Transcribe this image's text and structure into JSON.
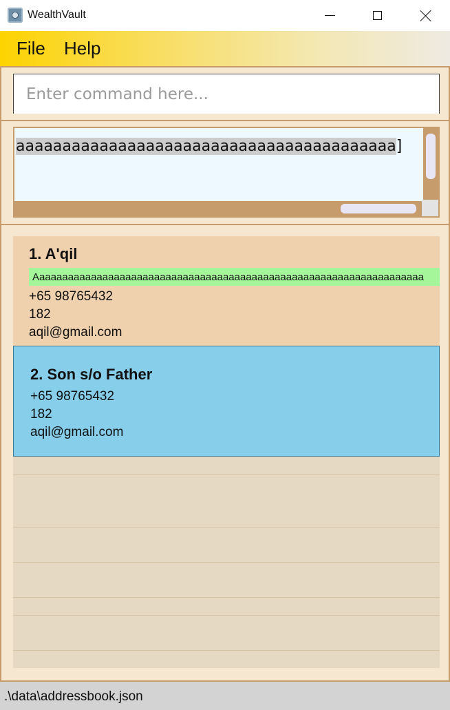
{
  "window": {
    "title": "WealthVault"
  },
  "menu": {
    "items": [
      "File",
      "Help"
    ]
  },
  "command": {
    "placeholder": "Enter command here...",
    "value": ""
  },
  "result": {
    "selected_text": "aaaaaaaaaaaaaaaaaaaaaaaaaaaaaaaaaaaaaaaaa",
    "trailing_text": "]"
  },
  "persons": [
    {
      "index_name": "1. A'qil",
      "tag": "Aaaaaaaaaaaaaaaaaaaaaaaaaaaaaaaaaaaaaaaaaaaaaaaaaaaaaaaaaaaaaaaaaaaa",
      "phone": "+65 98765432",
      "address": "182",
      "email": "aqil@gmail.com"
    },
    {
      "index_name": "2. Son s/o Father",
      "phone": "+65 98765432",
      "address": "182",
      "email": "aqil@gmail.com"
    }
  ],
  "status": {
    "file_path": ".\\data\\addressbook.json"
  },
  "colors": {
    "accent": "#fdd300",
    "border": "#c69c6d",
    "selected_card": "#87ceeb",
    "tag": "#a5f59a"
  }
}
